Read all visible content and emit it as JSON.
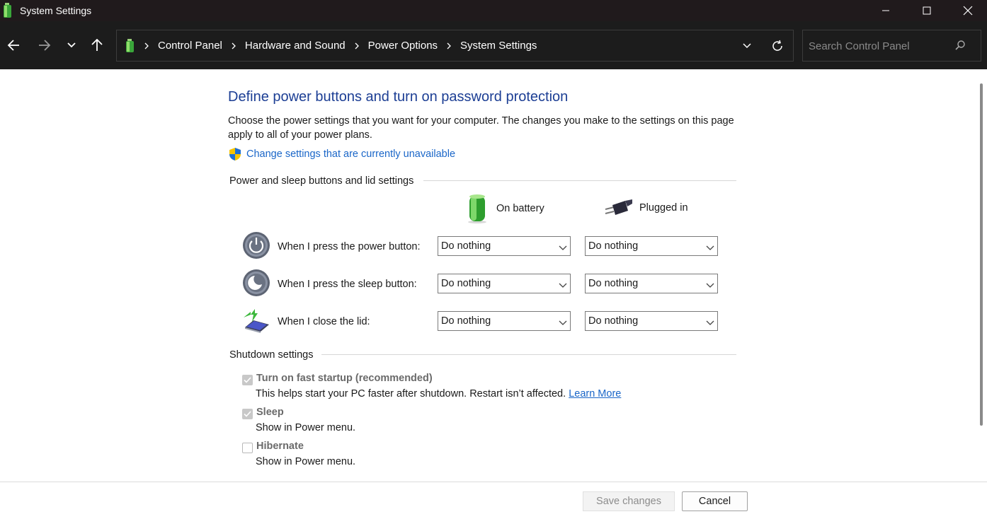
{
  "window": {
    "title": "System Settings",
    "colors": {
      "titlebar": "#201a1c",
      "navbar": "#1c1c1c",
      "heading": "#1c3e94",
      "link": "#1a66c8"
    }
  },
  "breadcrumb": [
    "Control Panel",
    "Hardware and Sound",
    "Power Options",
    "System Settings"
  ],
  "search": {
    "placeholder": "Search Control Panel"
  },
  "page": {
    "title": "Define power buttons and turn on password protection",
    "description": "Choose the power settings that you want for your computer. The changes you make to the settings on this page apply to all of your power plans.",
    "change_link": "Change settings that are currently unavailable"
  },
  "buttons_section": {
    "header": "Power and sleep buttons and lid settings",
    "col_battery": "On battery",
    "col_plugged": "Plugged in",
    "rows": [
      {
        "label": "When I press the power button:",
        "icon": "power-button-icon",
        "battery": "Do nothing",
        "plugged": "Do nothing"
      },
      {
        "label": "When I press the sleep button:",
        "icon": "sleep-button-icon",
        "battery": "Do nothing",
        "plugged": "Do nothing"
      },
      {
        "label": "When I close the lid:",
        "icon": "laptop-lid-icon",
        "battery": "Do nothing",
        "plugged": "Do nothing"
      }
    ]
  },
  "shutdown_section": {
    "header": "Shutdown settings",
    "items": [
      {
        "label": "Turn on fast startup (recommended)",
        "desc": "This helps start your PC faster after shutdown. Restart isn’t affected.",
        "link": "Learn More",
        "checked": true
      },
      {
        "label": "Sleep",
        "desc": "Show in Power menu.",
        "checked": true
      },
      {
        "label": "Hibernate",
        "desc": "Show in Power menu.",
        "checked": false
      }
    ]
  },
  "footer": {
    "save": "Save changes",
    "cancel": "Cancel"
  }
}
